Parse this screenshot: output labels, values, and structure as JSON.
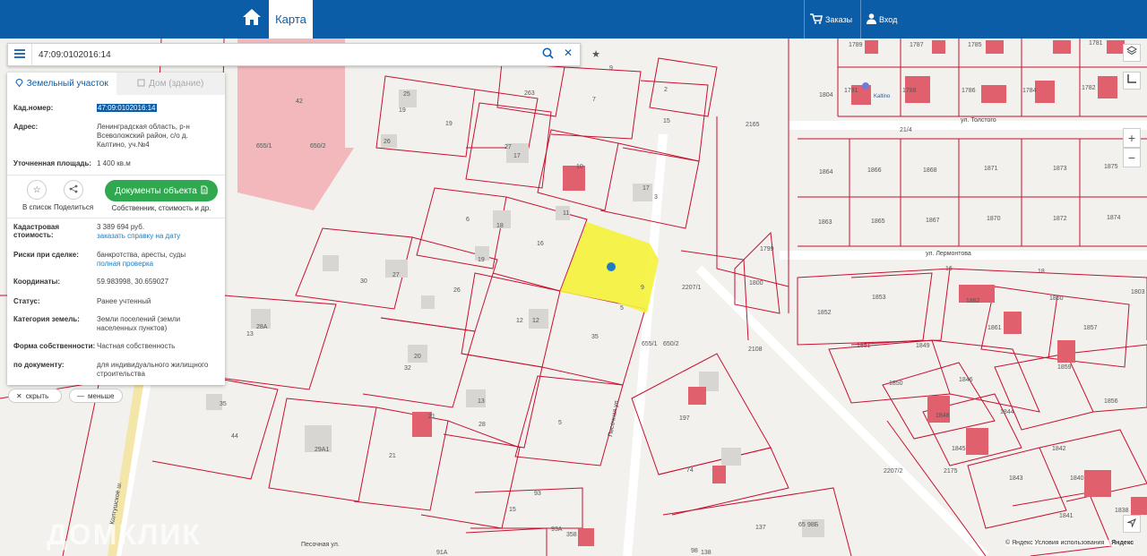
{
  "topbar": {
    "home_icon": "home-icon",
    "map_tab": "Карта",
    "orders": "Заказы",
    "login": "Вход",
    "brand_color": "#0b5da8"
  },
  "search": {
    "value": "47:09:0102016:14"
  },
  "panel": {
    "tab_land": "Земельный участок",
    "tab_house": "Дом (здание)",
    "cad_number_label": "Кад.номер:",
    "cad_number": "47:09:0102016:14",
    "address_label": "Адрес:",
    "address": "Ленинградская область, р-н Всеволожский район, с/о д. Калтино, уч.№4",
    "area_label": "Уточненная площадь:",
    "area": "1 400 кв.м",
    "add_to_list": "В список",
    "share": "Поделиться",
    "docs_button": "Документы объекта",
    "docs_sub": "Собственник, стоимость и др.",
    "cad_value_label": "Кадастровая стоимость:",
    "cad_value": "3 389 694 руб.",
    "order_certificate": "заказать справку на дату",
    "risks_label": "Риски при сделке:",
    "risks": "банкротства, аресты, суды",
    "full_check": "полная проверка",
    "coords_label": "Координаты:",
    "coords": "59.983998, 30.659027",
    "status_label": "Статус:",
    "status": "Ранее учтенный",
    "category_label": "Категория земель:",
    "category": "Земли поселений (земли населенных пунктов)",
    "ownership_label": "Форма собственности:",
    "ownership": "Частная собственность",
    "document_label": "по документу:",
    "document": "для индивидуального жилищного строительства"
  },
  "controls": {
    "hide": "скрыть",
    "less": "меньше"
  },
  "map": {
    "streets": [
      "ул. Толстого",
      "ул. Лермонтова",
      "Песочная ул.",
      "Колтушское ш.",
      "Песочная ул."
    ],
    "village": "Kaltino",
    "parcels_left": [
      "42",
      "655/1",
      "650/2",
      "25",
      "19",
      "19",
      "26",
      "263",
      "7",
      "9",
      "2",
      "15",
      "27",
      "17",
      "10",
      "6",
      "18",
      "11",
      "3",
      "17",
      "16",
      "30",
      "27",
      "19",
      "26",
      "9",
      "5",
      "28А",
      "13",
      "12",
      "12",
      "35",
      "20",
      "32",
      "35",
      "44",
      "13",
      "28",
      "21",
      "5",
      "29А1",
      "21",
      "197",
      "74",
      "15",
      "93",
      "93А",
      "358",
      "91А",
      "98",
      "138",
      "137",
      "65",
      "98Б",
      "2207/1",
      "655/1",
      "650/2",
      "2165",
      "1800",
      "1799",
      "2108"
    ],
    "parcels_right": [
      "1789",
      "1787",
      "1785",
      "1781",
      "1804",
      "1791",
      "1788",
      "1786",
      "1784",
      "1782",
      "21/4",
      "1864",
      "1866",
      "1868",
      "1871",
      "1873",
      "1875",
      "1863",
      "1865",
      "1867",
      "1870",
      "1872",
      "1874",
      "16",
      "18",
      "1852",
      "1853",
      "1862",
      "1860",
      "1803",
      "1851",
      "1849",
      "1861",
      "1857",
      "1850",
      "1846",
      "1859",
      "1848",
      "1844",
      "1856",
      "1845",
      "1842",
      "1843",
      "1840",
      "1841",
      "1838",
      "2207/2",
      "2175"
    ],
    "attribution": "© Яндекс Условия использования",
    "yandex": "Яндекс",
    "watermark": "ДОМКЛИК",
    "parcel_color": "#c8102e",
    "selected_color": "#f5f23a"
  }
}
